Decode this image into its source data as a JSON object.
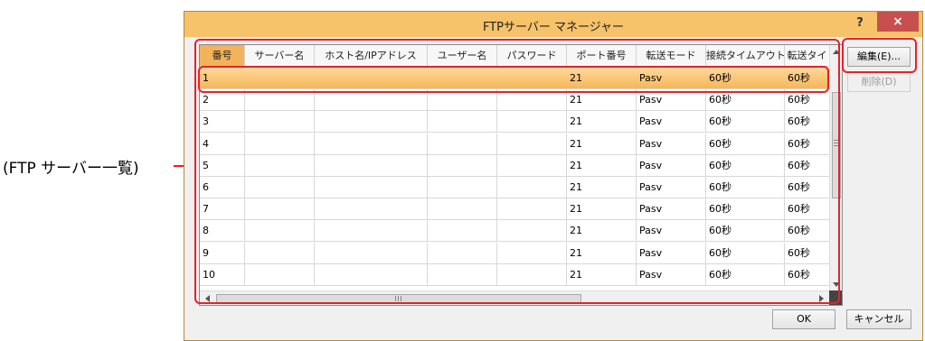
{
  "callout": {
    "label": "(FTP サーバー一覧)"
  },
  "dialog": {
    "title": "FTPサーバー マネージャー",
    "help_label": "?",
    "close_label": "×"
  },
  "columns": [
    {
      "label": "番号",
      "key": "no",
      "active": true
    },
    {
      "label": "サーバー名",
      "key": "server"
    },
    {
      "label": "ホスト名/IPアドレス",
      "key": "host"
    },
    {
      "label": "ユーザー名",
      "key": "user"
    },
    {
      "label": "パスワード",
      "key": "password"
    },
    {
      "label": "ポート番号",
      "key": "port"
    },
    {
      "label": "転送モード",
      "key": "mode"
    },
    {
      "label": "接続タイムアウト",
      "key": "connect_timeout"
    },
    {
      "label": "転送タイ",
      "key": "transfer_timeout"
    }
  ],
  "rows": [
    {
      "no": "1",
      "server": "",
      "host": "",
      "user": "",
      "password": "",
      "port": "21",
      "mode": "Pasv",
      "connect_timeout": "60秒",
      "transfer_timeout": "60秒",
      "selected": true
    },
    {
      "no": "2",
      "server": "",
      "host": "",
      "user": "",
      "password": "",
      "port": "21",
      "mode": "Pasv",
      "connect_timeout": "60秒",
      "transfer_timeout": "60秒"
    },
    {
      "no": "3",
      "server": "",
      "host": "",
      "user": "",
      "password": "",
      "port": "21",
      "mode": "Pasv",
      "connect_timeout": "60秒",
      "transfer_timeout": "60秒"
    },
    {
      "no": "4",
      "server": "",
      "host": "",
      "user": "",
      "password": "",
      "port": "21",
      "mode": "Pasv",
      "connect_timeout": "60秒",
      "transfer_timeout": "60秒"
    },
    {
      "no": "5",
      "server": "",
      "host": "",
      "user": "",
      "password": "",
      "port": "21",
      "mode": "Pasv",
      "connect_timeout": "60秒",
      "transfer_timeout": "60秒"
    },
    {
      "no": "6",
      "server": "",
      "host": "",
      "user": "",
      "password": "",
      "port": "21",
      "mode": "Pasv",
      "connect_timeout": "60秒",
      "transfer_timeout": "60秒"
    },
    {
      "no": "7",
      "server": "",
      "host": "",
      "user": "",
      "password": "",
      "port": "21",
      "mode": "Pasv",
      "connect_timeout": "60秒",
      "transfer_timeout": "60秒"
    },
    {
      "no": "8",
      "server": "",
      "host": "",
      "user": "",
      "password": "",
      "port": "21",
      "mode": "Pasv",
      "connect_timeout": "60秒",
      "transfer_timeout": "60秒"
    },
    {
      "no": "9",
      "server": "",
      "host": "",
      "user": "",
      "password": "",
      "port": "21",
      "mode": "Pasv",
      "connect_timeout": "60秒",
      "transfer_timeout": "60秒"
    },
    {
      "no": "10",
      "server": "",
      "host": "",
      "user": "",
      "password": "",
      "port": "21",
      "mode": "Pasv",
      "connect_timeout": "60秒",
      "transfer_timeout": "60秒"
    }
  ],
  "buttons": {
    "edit": "編集(E)...",
    "delete": "削除(D)",
    "ok": "OK",
    "cancel": "キャンセル"
  },
  "colors": {
    "titlebar": "#f6c26a",
    "selected_row": "#f6b659",
    "highlight": "#e8202a",
    "close": "#c7504f"
  }
}
